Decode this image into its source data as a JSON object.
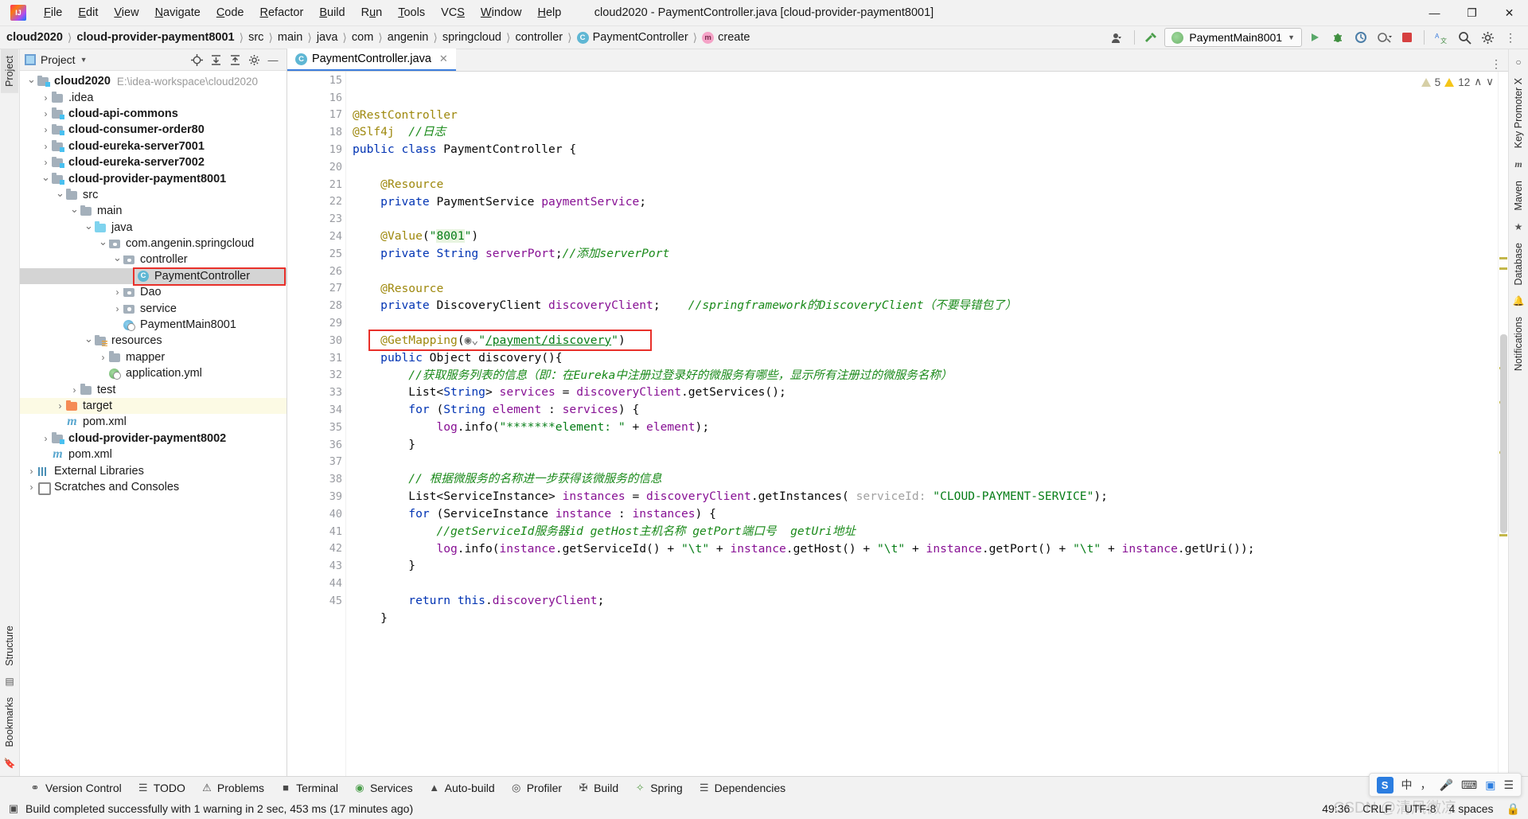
{
  "window": {
    "title": "cloud2020 - PaymentController.java [cloud-provider-payment8001]",
    "minimize": "—",
    "maximize": "❐",
    "close": "✕"
  },
  "menu": [
    "File",
    "Edit",
    "View",
    "Navigate",
    "Code",
    "Refactor",
    "Build",
    "Run",
    "Tools",
    "VCS",
    "Window",
    "Help"
  ],
  "breadcrumb": [
    {
      "label": "cloud2020",
      "bold": true,
      "icon": ""
    },
    {
      "label": "cloud-provider-payment8001",
      "bold": true,
      "icon": ""
    },
    {
      "label": "src",
      "bold": false,
      "icon": ""
    },
    {
      "label": "main",
      "bold": false,
      "icon": ""
    },
    {
      "label": "java",
      "bold": false,
      "icon": ""
    },
    {
      "label": "com",
      "bold": false,
      "icon": ""
    },
    {
      "label": "angenin",
      "bold": false,
      "icon": ""
    },
    {
      "label": "springcloud",
      "bold": false,
      "icon": ""
    },
    {
      "label": "controller",
      "bold": false,
      "icon": ""
    },
    {
      "label": "PaymentController",
      "bold": false,
      "icon": "class-icon"
    },
    {
      "label": "create",
      "bold": false,
      "icon": "method-icon"
    }
  ],
  "toolbar": {
    "run_config": "PaymentMain8001",
    "icons": [
      "user-avatar-icon",
      "hammer-build-icon",
      "run-icon",
      "debug-icon",
      "run-with-coverage-icon",
      "profiler-icon",
      "stop-icon",
      "translate-icon",
      "search-icon",
      "settings-icon",
      "more-icon"
    ]
  },
  "project_panel": {
    "title": "Project",
    "actions": [
      "locate-icon",
      "expand-all-icon",
      "collapse-all-icon",
      "gear-icon",
      "hide-icon"
    ],
    "tree": [
      {
        "label": "cloud2020",
        "path": "E:\\idea-workspace\\cloud2020",
        "depth": 0,
        "arrow": "down",
        "icon": "module",
        "bold": true
      },
      {
        "label": ".idea",
        "depth": 1,
        "arrow": "right",
        "icon": "folder",
        "bold": false
      },
      {
        "label": "cloud-api-commons",
        "depth": 1,
        "arrow": "right",
        "icon": "module",
        "bold": true
      },
      {
        "label": "cloud-consumer-order80",
        "depth": 1,
        "arrow": "right",
        "icon": "module",
        "bold": true
      },
      {
        "label": "cloud-eureka-server7001",
        "depth": 1,
        "arrow": "right",
        "icon": "module",
        "bold": true
      },
      {
        "label": "cloud-eureka-server7002",
        "depth": 1,
        "arrow": "right",
        "icon": "module",
        "bold": true
      },
      {
        "label": "cloud-provider-payment8001",
        "depth": 1,
        "arrow": "down",
        "icon": "module",
        "bold": true
      },
      {
        "label": "src",
        "depth": 2,
        "arrow": "down",
        "icon": "folder",
        "bold": false
      },
      {
        "label": "main",
        "depth": 3,
        "arrow": "down",
        "icon": "folder",
        "bold": false
      },
      {
        "label": "java",
        "depth": 4,
        "arrow": "down",
        "icon": "folder-blue",
        "bold": false
      },
      {
        "label": "com.angenin.springcloud",
        "depth": 5,
        "arrow": "down",
        "icon": "package",
        "bold": false
      },
      {
        "label": "controller",
        "depth": 6,
        "arrow": "down",
        "icon": "package",
        "bold": false
      },
      {
        "label": "PaymentController",
        "depth": 7,
        "arrow": "none",
        "icon": "class",
        "bold": false,
        "selected": true,
        "highlighted_red": true
      },
      {
        "label": "Dao",
        "depth": 6,
        "arrow": "right",
        "icon": "package",
        "bold": false
      },
      {
        "label": "service",
        "depth": 6,
        "arrow": "right",
        "icon": "package",
        "bold": false
      },
      {
        "label": "PaymentMain8001",
        "depth": 6,
        "arrow": "none",
        "icon": "spring-blue",
        "bold": false
      },
      {
        "label": "resources",
        "depth": 4,
        "arrow": "down",
        "icon": "folder-res",
        "bold": false
      },
      {
        "label": "mapper",
        "depth": 5,
        "arrow": "right",
        "icon": "folder",
        "bold": false
      },
      {
        "label": "application.yml",
        "depth": 5,
        "arrow": "none",
        "icon": "spring",
        "bold": false
      },
      {
        "label": "test",
        "depth": 3,
        "arrow": "right",
        "icon": "folder",
        "bold": false
      },
      {
        "label": "target",
        "depth": 2,
        "arrow": "right",
        "icon": "folder-orange",
        "bold": false,
        "row_highlight": true
      },
      {
        "label": "pom.xml",
        "depth": 2,
        "arrow": "none",
        "icon": "maven",
        "bold": false
      },
      {
        "label": "cloud-provider-payment8002",
        "depth": 1,
        "arrow": "right",
        "icon": "module",
        "bold": true
      },
      {
        "label": "pom.xml",
        "depth": 1,
        "arrow": "none",
        "icon": "maven",
        "bold": false
      },
      {
        "label": "External Libraries",
        "depth": 0,
        "arrow": "right",
        "icon": "libraries",
        "bold": false
      },
      {
        "label": "Scratches and Consoles",
        "depth": 0,
        "arrow": "right",
        "icon": "scratches",
        "bold": false
      }
    ]
  },
  "left_strip": {
    "tabs": [
      "Project",
      "Bookmarks",
      "Structure"
    ]
  },
  "right_strip": {
    "tabs": [
      "Key Promoter X",
      "Maven",
      "Database",
      "Notifications"
    ]
  },
  "editor": {
    "tab_name": "PaymentController.java",
    "tab_close": "✕",
    "inspection": {
      "weak_warnings": "5",
      "warnings": "12",
      "up": "∧",
      "down": "∨"
    },
    "first_line_number": 15,
    "lines": [
      {
        "n": 15,
        "text": "@RestController"
      },
      {
        "n": 16,
        "text": "@Slf4j  //日志"
      },
      {
        "n": 17,
        "text": "public class PaymentController {"
      },
      {
        "n": 18,
        "text": ""
      },
      {
        "n": 19,
        "text": "    @Resource"
      },
      {
        "n": 20,
        "text": "    private PaymentService paymentService;"
      },
      {
        "n": 21,
        "text": ""
      },
      {
        "n": 22,
        "text": "    @Value(\"8001\")"
      },
      {
        "n": 23,
        "text": "    private String serverPort;//添加serverPort"
      },
      {
        "n": 24,
        "text": ""
      },
      {
        "n": 25,
        "text": "    @Resource"
      },
      {
        "n": 26,
        "text": "    private DiscoveryClient discoveryClient;    //springframework的DiscoveryClient（不要导错包了）"
      },
      {
        "n": 27,
        "text": ""
      },
      {
        "n": 28,
        "text": "    @GetMapping(\"/payment/discovery\")"
      },
      {
        "n": 29,
        "text": "    public Object discovery(){"
      },
      {
        "n": 30,
        "text": "        //获取服务列表的信息（即：在Eureka中注册过登录好的微服务有哪些，显示所有注册过的微服务名称）"
      },
      {
        "n": 31,
        "text": "        List<String> services = discoveryClient.getServices();"
      },
      {
        "n": 32,
        "text": "        for (String element : services) {"
      },
      {
        "n": 33,
        "text": "            log.info(\"*******element: \" + element);"
      },
      {
        "n": 34,
        "text": "        }"
      },
      {
        "n": 35,
        "text": ""
      },
      {
        "n": 36,
        "text": "        // 根据微服务的名称进一步获得该微服务的信息"
      },
      {
        "n": 37,
        "text": "        List<ServiceInstance> instances = discoveryClient.getInstances( serviceId: \"CLOUD-PAYMENT-SERVICE\");"
      },
      {
        "n": 38,
        "text": "        for (ServiceInstance instance : instances) {"
      },
      {
        "n": 39,
        "text": "            //getServiceId服务器id getHost主机名称 getPort端口号  getUri地址"
      },
      {
        "n": 40,
        "text": "            log.info(instance.getServiceId() + \"\\t\" + instance.getHost() + \"\\t\" + instance.getPort() + \"\\t\" + instance.getUri());"
      },
      {
        "n": 41,
        "text": "        }"
      },
      {
        "n": 42,
        "text": ""
      },
      {
        "n": 43,
        "text": "        return this.discoveryClient;"
      },
      {
        "n": 44,
        "text": "    }"
      },
      {
        "n": 45,
        "text": ""
      }
    ]
  },
  "bottom_tools": [
    {
      "label": "Version Control",
      "icon": "branch-icon"
    },
    {
      "label": "TODO",
      "icon": "list-icon"
    },
    {
      "label": "Problems",
      "icon": "error-icon"
    },
    {
      "label": "Terminal",
      "icon": "terminal-icon"
    },
    {
      "label": "Services",
      "icon": "services-icon"
    },
    {
      "label": "Auto-build",
      "icon": "warning-triangle-icon"
    },
    {
      "label": "Profiler",
      "icon": "profiler-icon"
    },
    {
      "label": "Build",
      "icon": "hammer-icon"
    },
    {
      "label": "Spring",
      "icon": "spring-leaf-icon"
    },
    {
      "label": "Dependencies",
      "icon": "layers-icon"
    }
  ],
  "status": {
    "build_message": "Build completed successfully with 1 warning in 2 sec, 453 ms (17 minutes ago)",
    "caret": "49:36",
    "line_sep": "CRLF",
    "encoding": "UTF-8",
    "indent": "4 spaces",
    "watermark": "CSDN @清风微凉",
    "lock_icon": "lock-icon"
  },
  "ime": {
    "logo": "S",
    "lang": "中",
    "items": [
      "comma-icon",
      "mic-icon",
      "keyboard-icon",
      "toolbox-icon",
      "menu-icon"
    ]
  }
}
